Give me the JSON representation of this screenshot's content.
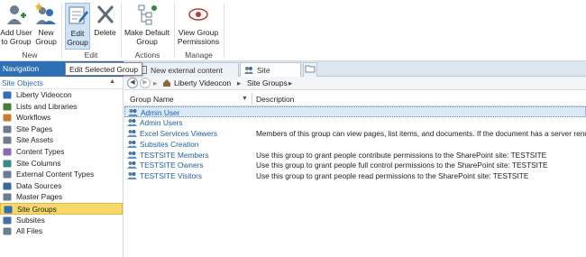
{
  "ribbon": {
    "buttons": {
      "add_user": "Add User\nto Group",
      "new_group": "New\nGroup",
      "edit_group": "Edit\nGroup",
      "delete": "Delete",
      "make_default": "Make Default\nGroup",
      "view_permissions": "View Group\nPermissions"
    },
    "groups": {
      "new": "New",
      "edit": "Edit",
      "actions": "Actions",
      "manage": "Manage"
    }
  },
  "nav": {
    "title": "Navigation",
    "tooltip": "Edit Selected Group",
    "tabs": [
      "New external content type *",
      "Site Groups"
    ]
  },
  "left": {
    "header": "Site Objects",
    "items": [
      "Liberty Videocon",
      "Lists and Libraries",
      "Workflows",
      "Site Pages",
      "Site Assets",
      "Content Types",
      "Site Columns",
      "External Content Types",
      "Data Sources",
      "Master Pages",
      "Site Groups",
      "Subsites",
      "All Files"
    ],
    "selected": "Site Groups"
  },
  "breadcrumb": [
    "Liberty Videocon",
    "Site Groups"
  ],
  "grid": {
    "columns": [
      "Group Name",
      "Description"
    ],
    "rows": [
      {
        "name": "Admin User",
        "desc": ""
      },
      {
        "name": "Admin Users",
        "desc": ""
      },
      {
        "name": "Excel Services Viewers",
        "desc": "Members of this group can view pages, list items, and documents.  If the document has a server rende"
      },
      {
        "name": "Subsites Creation",
        "desc": ""
      },
      {
        "name": "TESTSITE Members",
        "desc": "Use this group to grant people contribute permissions to the SharePoint site: TESTSITE"
      },
      {
        "name": "TESTSITE Owners",
        "desc": "Use this group to grant people full control permissions to the SharePoint site: TESTSITE"
      },
      {
        "name": "TESTSITE Visitors",
        "desc": "Use this group to grant people read permissions to the SharePoint site: TESTSITE"
      }
    ]
  },
  "colors": {
    "nav_blue": "#2e6fb5",
    "selection_yellow": "#f6d86b",
    "link_blue": "#2060a8"
  }
}
